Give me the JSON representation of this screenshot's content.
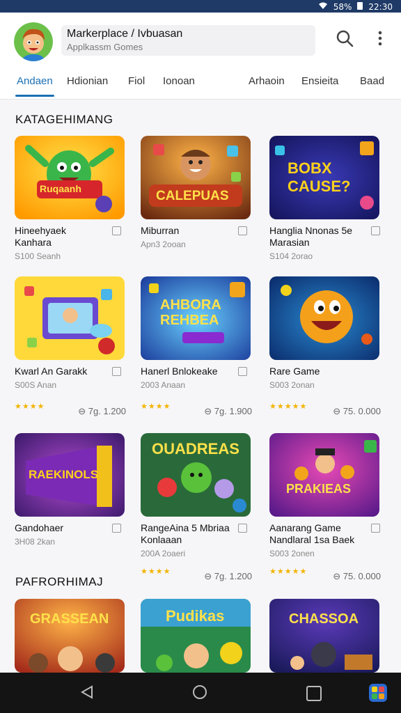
{
  "status": {
    "wifi_icon": "wifi-icon",
    "battery": "58%",
    "time": "22:30"
  },
  "header": {
    "title": "Markerplace / Ivbuasan",
    "subtitle": "Applkassm Gomes",
    "search_icon": "search-icon",
    "menu_icon": "more-vert-icon"
  },
  "tabs": [
    "Andaen",
    "Hdionian",
    "Fiol",
    "Ionoan",
    "Arhaoin",
    "Ensieita",
    "Baad"
  ],
  "section1": {
    "title": "KATAGEHIMANG"
  },
  "section2": {
    "title": "PAFRORHIMAJ"
  },
  "cards": [
    {
      "name": "Hineehyaek Kanhara",
      "meta": "S100 Seanh",
      "art": "Ruqaanh"
    },
    {
      "name": "Miburran",
      "meta": "Apn3 2ooan",
      "art": "CALEPUAS"
    },
    {
      "name": "Hanglia Nnonas 5e Marasian",
      "meta": "S104 2orao",
      "art": "BOBX CAUSE?"
    },
    {
      "name": "Kwarl An Garakk",
      "meta": "S00S Anan",
      "size": "7g. 1.200",
      "stars": "★★★★",
      "art": ""
    },
    {
      "name": "Hanerl Bnlokeake",
      "meta": "2003 Anaan",
      "size": "7g. 1.900",
      "stars": "★★★★",
      "art": "AHBORA REHBEA"
    },
    {
      "name": "Rare Game",
      "meta": "S003 2onan",
      "size": "75. 0.000",
      "stars": "★★★★★",
      "art": ""
    },
    {
      "name": "Gandohaer",
      "meta": "3H08 2kan",
      "art": "RAEKINOLS"
    },
    {
      "name": "RangeAina 5 Mbriaa Konlaaan",
      "meta": "200A 2oaeri",
      "size": "7g. 1.200",
      "stars": "★★★★",
      "art": "OUADREAS"
    },
    {
      "name": "Aanarang Game Nandlaral 1sa Baek",
      "meta": "S003 2onen",
      "size": "75. 0.000",
      "stars": "★★★★★",
      "art": "PRAKIEAS"
    },
    {
      "name": "",
      "meta": "",
      "art": "GRASSEAN"
    },
    {
      "name": "",
      "meta": "",
      "art": "Pudikas"
    },
    {
      "name": "",
      "meta": "",
      "art": "CHASSOA"
    }
  ],
  "nav": {
    "back_icon": "back-triangle-icon",
    "home_icon": "home-circle-icon",
    "recents_icon": "recents-square-icon",
    "app_icon": "app-shortcut-icon"
  },
  "colors": {
    "accent": "#1a6fb3",
    "statusbar": "#1f3a66",
    "navbar": "#141414",
    "stars": "#f2b400"
  }
}
